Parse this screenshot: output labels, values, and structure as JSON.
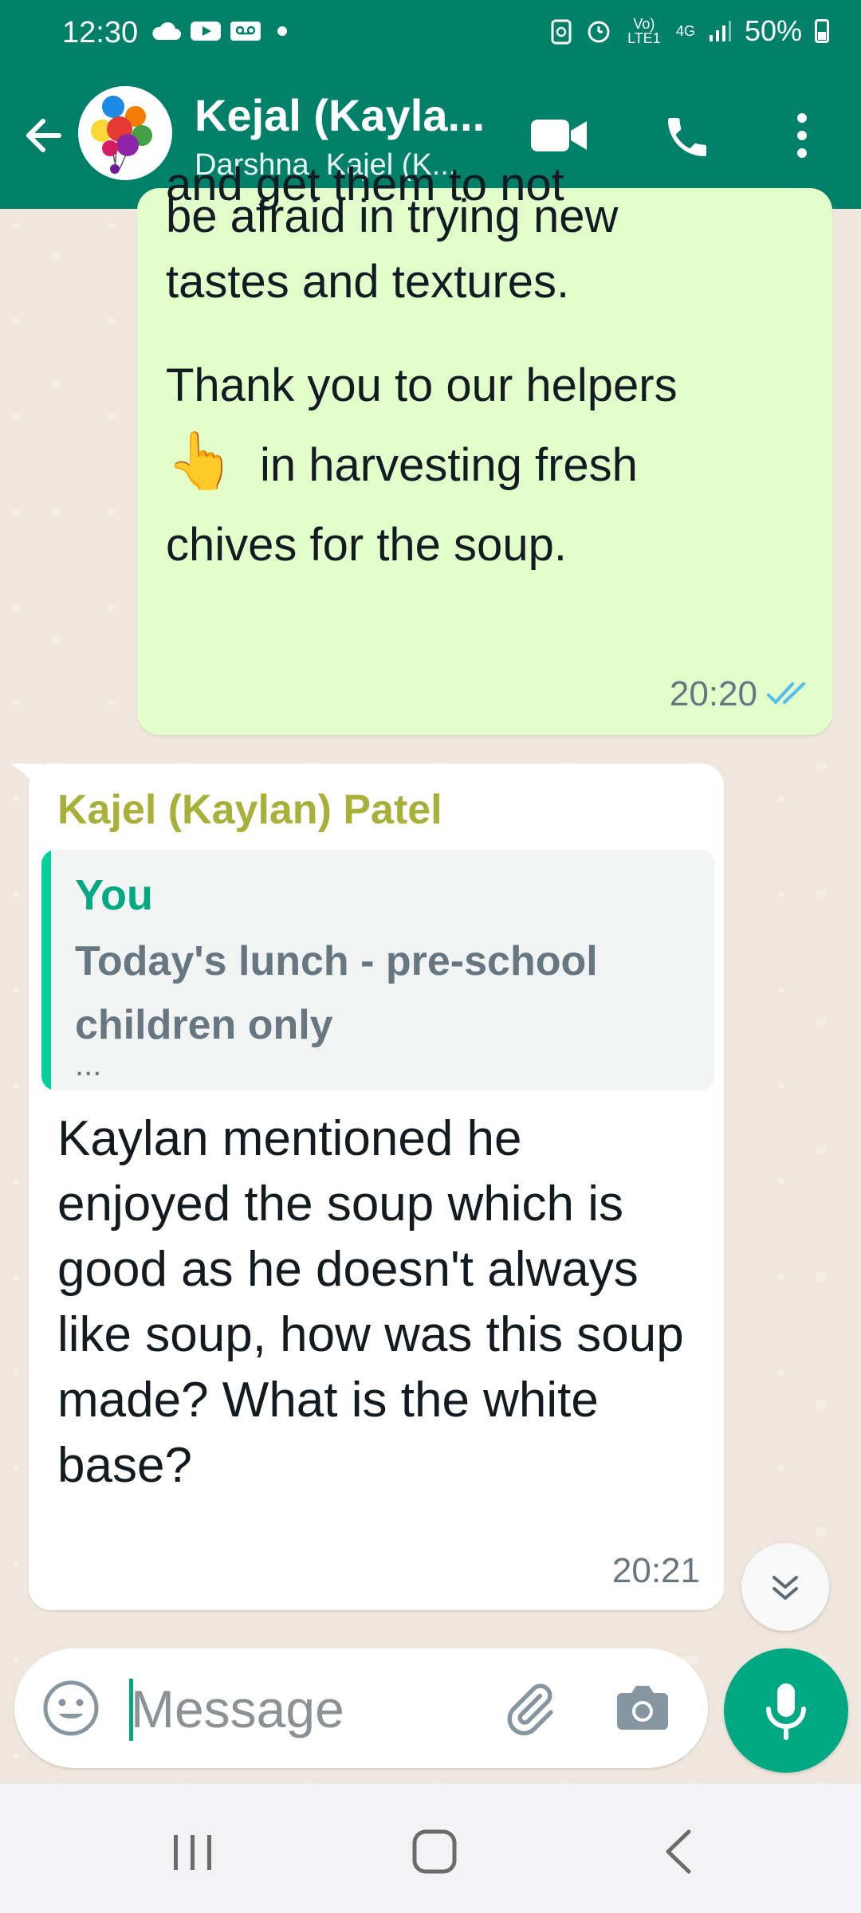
{
  "status_bar": {
    "time": "12:30",
    "network_label": "Vo) LTE1",
    "network_gen": "4G",
    "battery": "50%"
  },
  "header": {
    "title": "Kejal (Kayla...",
    "subtitle": "Darshna, Kajel (K...",
    "color": "#008069"
  },
  "messages": [
    {
      "direction": "outgoing",
      "lines": [
        "and get them to not",
        "be afraid in trying new",
        "tastes and textures.",
        "Thank you to our helpers",
        "in harvesting fresh",
        "chives for the soup."
      ],
      "emoji": "👆",
      "time": "20:20",
      "status": "read"
    },
    {
      "direction": "incoming",
      "sender": "Kajel (Kaylan) Patel",
      "quote": {
        "author": "You",
        "text": "Today's lunch - pre-school children only",
        "more": "..."
      },
      "text": "Kaylan mentioned he enjoyed the soup which is good as he doesn't always like soup, how was this soup made? What is the white base?",
      "time": "20:21"
    }
  ],
  "composer": {
    "placeholder": "Message"
  },
  "icons": {
    "back": "arrow-left-icon",
    "video": "video-camera-icon",
    "call": "phone-icon",
    "more": "more-vertical-icon",
    "emoji": "emoji-icon",
    "attach": "paperclip-icon",
    "camera": "camera-icon",
    "mic": "microphone-icon",
    "scroll": "chevrons-down-icon"
  },
  "colors": {
    "outgoing_bubble": "#e2fecb",
    "accent": "#00a884",
    "sender_name": "#a8b03a",
    "read_ticks": "#53bdeb"
  }
}
